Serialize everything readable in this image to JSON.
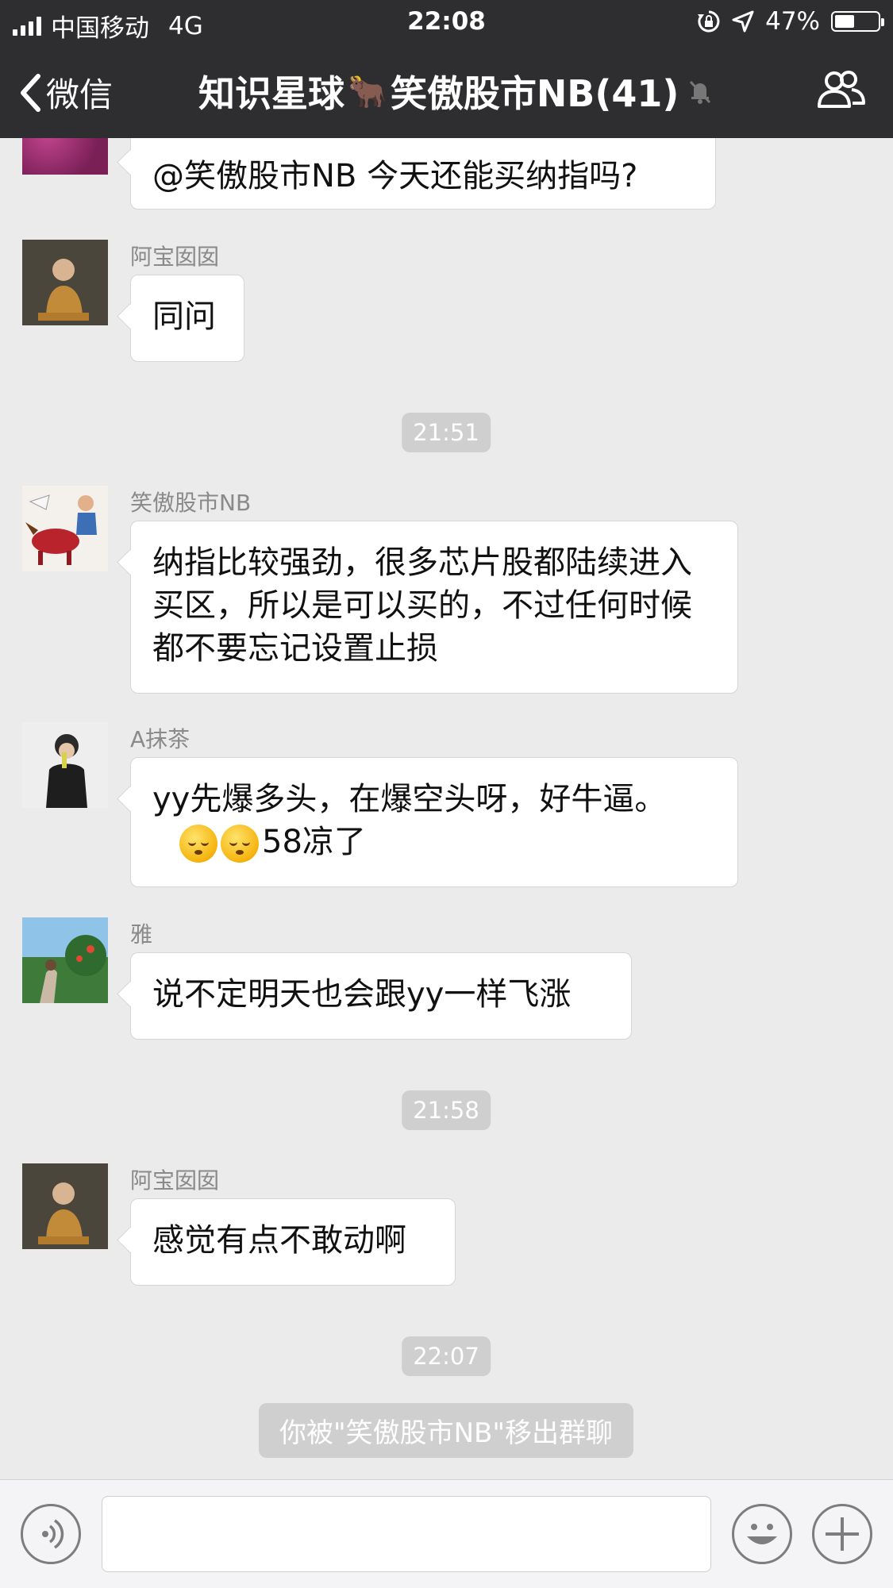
{
  "status_bar": {
    "carrier": "中国移动",
    "network": "4G",
    "time": "22:08",
    "battery": "47%",
    "battery_level": 0.47
  },
  "nav": {
    "back_label": "微信",
    "title_prefix": "知识星球",
    "title_emoji": "🐂",
    "title_name": "笑傲股市NB(41)"
  },
  "messages": [
    {
      "sender": "",
      "text": "@笑傲股市NB 今天还能买纳指吗?"
    },
    {
      "sender": "阿宝囡囡",
      "text": "同问"
    },
    {
      "sender": "笑傲股市NB",
      "text": "纳指比较强劲，很多芯片股都陆续进入买区，所以是可以买的，不过任何时候都不要忘记设置止损"
    },
    {
      "sender": "A抹茶",
      "text_line1": "yy先爆多头，在爆空头呀，好牛逼。",
      "text_line2": "58凉了"
    },
    {
      "sender": "雅",
      "text": "说不定明天也会跟yy一样飞涨"
    },
    {
      "sender": "阿宝囡囡",
      "text": "感觉有点不敢动啊"
    }
  ],
  "timestamps": [
    "21:51",
    "21:58",
    "22:07"
  ],
  "system_message": "你被\"笑傲股市NB\"移出群聊",
  "icons": {
    "back": "chevron-left-icon",
    "mute": "bell-mute-icon",
    "members": "group-members-icon",
    "voice": "voice-icon",
    "emoji": "emoji-icon",
    "add": "plus-icon"
  },
  "colors": {
    "header": "#2e2e30",
    "background": "#ebebeb",
    "chip": "#cfcfcf"
  }
}
